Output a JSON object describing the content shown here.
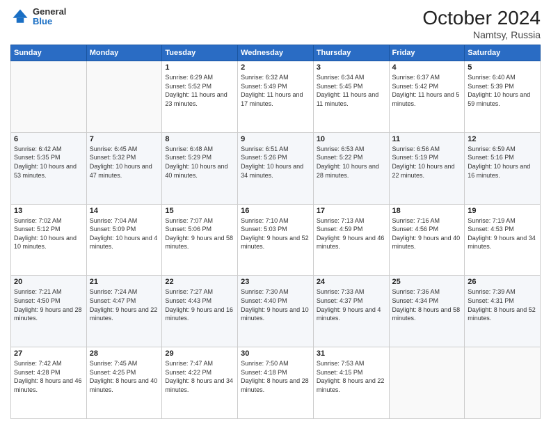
{
  "header": {
    "logo_general": "General",
    "logo_blue": "Blue",
    "month_title": "October 2024",
    "subtitle": "Namtsy, Russia"
  },
  "weekdays": [
    "Sunday",
    "Monday",
    "Tuesday",
    "Wednesday",
    "Thursday",
    "Friday",
    "Saturday"
  ],
  "weeks": [
    [
      {
        "day": "",
        "content": ""
      },
      {
        "day": "",
        "content": ""
      },
      {
        "day": "1",
        "content": "Sunrise: 6:29 AM\nSunset: 5:52 PM\nDaylight: 11 hours and 23 minutes."
      },
      {
        "day": "2",
        "content": "Sunrise: 6:32 AM\nSunset: 5:49 PM\nDaylight: 11 hours and 17 minutes."
      },
      {
        "day": "3",
        "content": "Sunrise: 6:34 AM\nSunset: 5:45 PM\nDaylight: 11 hours and 11 minutes."
      },
      {
        "day": "4",
        "content": "Sunrise: 6:37 AM\nSunset: 5:42 PM\nDaylight: 11 hours and 5 minutes."
      },
      {
        "day": "5",
        "content": "Sunrise: 6:40 AM\nSunset: 5:39 PM\nDaylight: 10 hours and 59 minutes."
      }
    ],
    [
      {
        "day": "6",
        "content": "Sunrise: 6:42 AM\nSunset: 5:35 PM\nDaylight: 10 hours and 53 minutes."
      },
      {
        "day": "7",
        "content": "Sunrise: 6:45 AM\nSunset: 5:32 PM\nDaylight: 10 hours and 47 minutes."
      },
      {
        "day": "8",
        "content": "Sunrise: 6:48 AM\nSunset: 5:29 PM\nDaylight: 10 hours and 40 minutes."
      },
      {
        "day": "9",
        "content": "Sunrise: 6:51 AM\nSunset: 5:26 PM\nDaylight: 10 hours and 34 minutes."
      },
      {
        "day": "10",
        "content": "Sunrise: 6:53 AM\nSunset: 5:22 PM\nDaylight: 10 hours and 28 minutes."
      },
      {
        "day": "11",
        "content": "Sunrise: 6:56 AM\nSunset: 5:19 PM\nDaylight: 10 hours and 22 minutes."
      },
      {
        "day": "12",
        "content": "Sunrise: 6:59 AM\nSunset: 5:16 PM\nDaylight: 10 hours and 16 minutes."
      }
    ],
    [
      {
        "day": "13",
        "content": "Sunrise: 7:02 AM\nSunset: 5:12 PM\nDaylight: 10 hours and 10 minutes."
      },
      {
        "day": "14",
        "content": "Sunrise: 7:04 AM\nSunset: 5:09 PM\nDaylight: 10 hours and 4 minutes."
      },
      {
        "day": "15",
        "content": "Sunrise: 7:07 AM\nSunset: 5:06 PM\nDaylight: 9 hours and 58 minutes."
      },
      {
        "day": "16",
        "content": "Sunrise: 7:10 AM\nSunset: 5:03 PM\nDaylight: 9 hours and 52 minutes."
      },
      {
        "day": "17",
        "content": "Sunrise: 7:13 AM\nSunset: 4:59 PM\nDaylight: 9 hours and 46 minutes."
      },
      {
        "day": "18",
        "content": "Sunrise: 7:16 AM\nSunset: 4:56 PM\nDaylight: 9 hours and 40 minutes."
      },
      {
        "day": "19",
        "content": "Sunrise: 7:19 AM\nSunset: 4:53 PM\nDaylight: 9 hours and 34 minutes."
      }
    ],
    [
      {
        "day": "20",
        "content": "Sunrise: 7:21 AM\nSunset: 4:50 PM\nDaylight: 9 hours and 28 minutes."
      },
      {
        "day": "21",
        "content": "Sunrise: 7:24 AM\nSunset: 4:47 PM\nDaylight: 9 hours and 22 minutes."
      },
      {
        "day": "22",
        "content": "Sunrise: 7:27 AM\nSunset: 4:43 PM\nDaylight: 9 hours and 16 minutes."
      },
      {
        "day": "23",
        "content": "Sunrise: 7:30 AM\nSunset: 4:40 PM\nDaylight: 9 hours and 10 minutes."
      },
      {
        "day": "24",
        "content": "Sunrise: 7:33 AM\nSunset: 4:37 PM\nDaylight: 9 hours and 4 minutes."
      },
      {
        "day": "25",
        "content": "Sunrise: 7:36 AM\nSunset: 4:34 PM\nDaylight: 8 hours and 58 minutes."
      },
      {
        "day": "26",
        "content": "Sunrise: 7:39 AM\nSunset: 4:31 PM\nDaylight: 8 hours and 52 minutes."
      }
    ],
    [
      {
        "day": "27",
        "content": "Sunrise: 7:42 AM\nSunset: 4:28 PM\nDaylight: 8 hours and 46 minutes."
      },
      {
        "day": "28",
        "content": "Sunrise: 7:45 AM\nSunset: 4:25 PM\nDaylight: 8 hours and 40 minutes."
      },
      {
        "day": "29",
        "content": "Sunrise: 7:47 AM\nSunset: 4:22 PM\nDaylight: 8 hours and 34 minutes."
      },
      {
        "day": "30",
        "content": "Sunrise: 7:50 AM\nSunset: 4:18 PM\nDaylight: 8 hours and 28 minutes."
      },
      {
        "day": "31",
        "content": "Sunrise: 7:53 AM\nSunset: 4:15 PM\nDaylight: 8 hours and 22 minutes."
      },
      {
        "day": "",
        "content": ""
      },
      {
        "day": "",
        "content": ""
      }
    ]
  ]
}
